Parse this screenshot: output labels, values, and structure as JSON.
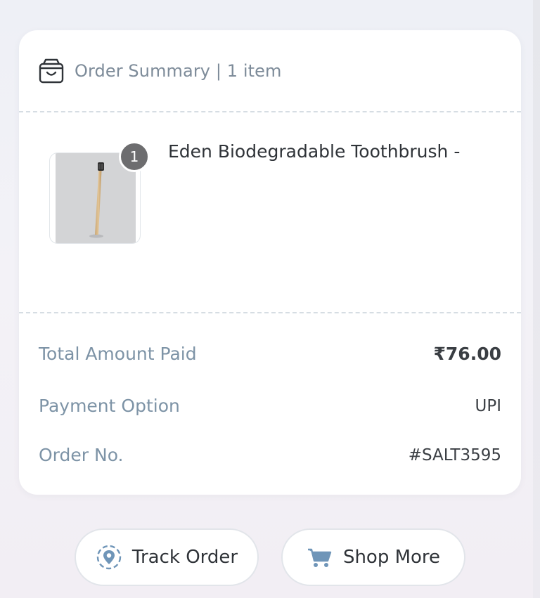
{
  "summary": {
    "icon": "shopping-bag-icon",
    "title": "Order Summary | 1 item"
  },
  "product": {
    "quantity": "1",
    "name": "Eden Biodegradable Toothbrush -",
    "image_icon": "toothbrush-image"
  },
  "totals": {
    "total_label": "Total Amount Paid",
    "total_value": "₹76.00",
    "payment_label": "Payment Option",
    "payment_value": "UPI",
    "order_label": "Order No.",
    "order_value": "#SALT3595"
  },
  "actions": {
    "track_label": "Track Order",
    "track_icon": "location-pin-icon",
    "shop_label": "Shop More",
    "shop_icon": "cart-icon"
  },
  "colors": {
    "muted_label": "#7d93a6",
    "icon_blue": "#6f95b8",
    "badge": "#6d6d6f"
  }
}
